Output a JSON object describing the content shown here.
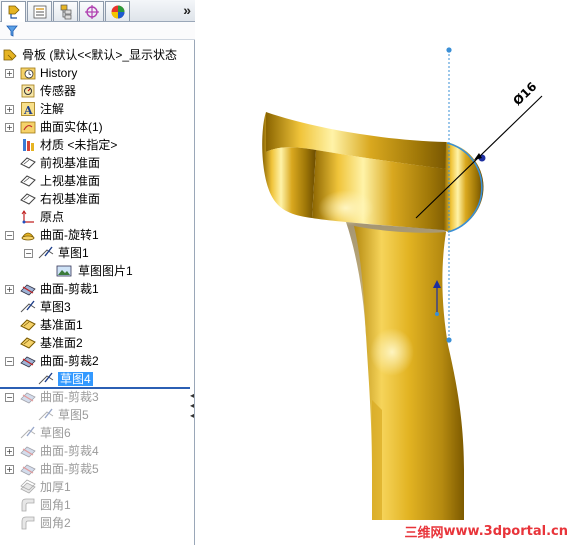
{
  "app": {
    "tabs": [
      {
        "name": "feature-manager-tab"
      },
      {
        "name": "property-manager-tab"
      },
      {
        "name": "configuration-manager-tab"
      },
      {
        "name": "dimxpert-manager-tab"
      },
      {
        "name": "display-manager-tab"
      }
    ],
    "more_label": "»"
  },
  "tree": {
    "root_label": "骨板 (默认<<默认>_显示状态",
    "items": [
      {
        "label": "History"
      },
      {
        "label": "传感器"
      },
      {
        "label": "注解"
      },
      {
        "label": "曲面实体(1)"
      },
      {
        "label": "材质 <未指定>"
      },
      {
        "label": "前视基准面"
      },
      {
        "label": "上视基准面"
      },
      {
        "label": "右视基准面"
      },
      {
        "label": "原点"
      },
      {
        "label": "曲面-旋转1"
      },
      {
        "label": "草图1"
      },
      {
        "label": "草图图片1"
      },
      {
        "label": "曲面-剪裁1"
      },
      {
        "label": "草图3"
      },
      {
        "label": "基准面1"
      },
      {
        "label": "基准面2"
      },
      {
        "label": "曲面-剪裁2"
      },
      {
        "label": "草图4"
      },
      {
        "label": "曲面-剪裁3"
      },
      {
        "label": "草图5"
      },
      {
        "label": "草图6"
      },
      {
        "label": "曲面-剪裁4"
      },
      {
        "label": "曲面-剪裁5"
      },
      {
        "label": "加厚1"
      },
      {
        "label": "圆角1"
      },
      {
        "label": "圆角2"
      }
    ]
  },
  "viewport": {
    "dimension_label": "Ø16",
    "model_color": "#d4a017",
    "sketch_color": "#3a8fd6"
  },
  "watermark": {
    "cn": "三维网",
    "url": "www.3dportal.cn"
  }
}
